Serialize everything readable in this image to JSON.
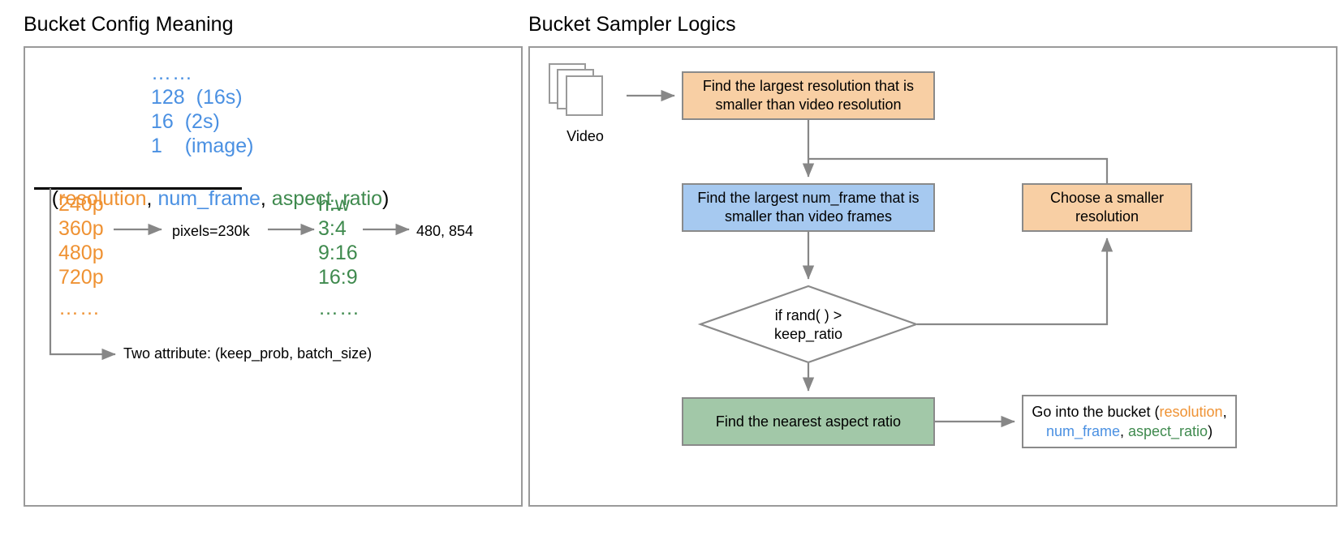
{
  "panels": {
    "left": {
      "title": "Bucket Config Meaning"
    },
    "right": {
      "title": "Bucket Sampler Logics"
    }
  },
  "left_panel": {
    "num_frame_list": [
      {
        "value": "……",
        "note": ""
      },
      {
        "value": "128",
        "note": "(16s)"
      },
      {
        "value": "16",
        "note": "(2s)"
      },
      {
        "value": "1",
        "note": "(image)"
      }
    ],
    "signature": {
      "open_paren": "(",
      "resolution": "resolution",
      "comma1": ", ",
      "num_frame": "num_frame",
      "comma2": ", ",
      "aspect_ratio": "aspect_ratio",
      "close_paren": ")"
    },
    "resolution_list": [
      "240p",
      "360p",
      "480p",
      "720p",
      "……"
    ],
    "aspect_ratio_header": "h:w",
    "aspect_ratio_list": [
      "3:4",
      "9:16",
      "16:9",
      "……"
    ],
    "pixels_label": "pixels=230k",
    "output_label": "480, 854",
    "attribute_note": "Two attribute: (keep_prob, batch_size)"
  },
  "right_panel": {
    "video_label": "Video",
    "boxes": {
      "find_resolution": "Find the largest resolution that is smaller than video resolution",
      "find_num_frame": "Find the largest num_frame that is smaller than video frames",
      "choose_smaller": "Choose a smaller resolution",
      "find_aspect_ratio": "Find the nearest aspect ratio"
    },
    "decision": {
      "line1": "if rand( ) >",
      "line2": "keep_ratio"
    },
    "bucket_box": {
      "prefix": "Go into the bucket  (",
      "resolution": "resolution",
      "comma1": ",",
      "num_frame": "num_frame",
      "comma2": ", ",
      "aspect_ratio": "aspect_ratio",
      "close_paren": ")"
    }
  },
  "colors": {
    "resolution": "#ef9233",
    "num_frame": "#4a90e2",
    "aspect_ratio": "#3f8a4e",
    "box_orange": "#f8cfa4",
    "box_blue": "#a6c9f0",
    "box_green": "#a2c8a8",
    "stroke": "#8a8a8a"
  }
}
